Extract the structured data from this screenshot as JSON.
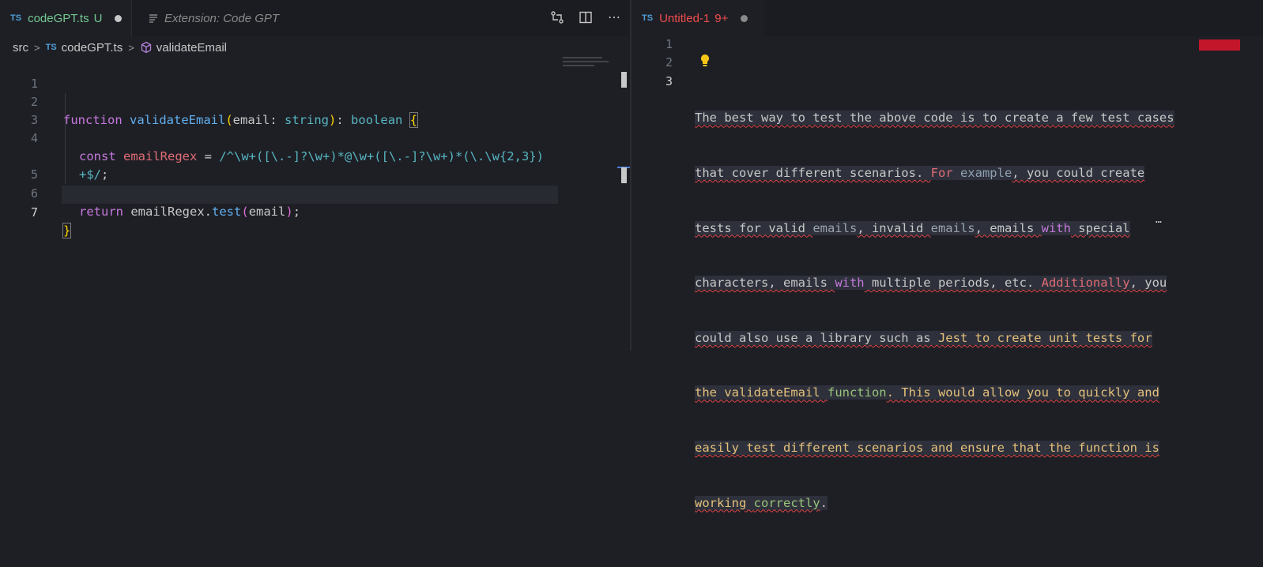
{
  "left_tabs": [
    {
      "badge": "TS",
      "title": "codeGPT.ts",
      "status": "U"
    },
    {
      "title": "Extension: Code GPT"
    }
  ],
  "breadcrumb": {
    "folder": "src",
    "file_badge": "TS",
    "file": "codeGPT.ts",
    "symbol": "validateEmail"
  },
  "left_code": {
    "line_numbers": [
      "1",
      "2",
      "3",
      "4",
      "",
      "5",
      "6",
      "7"
    ],
    "l2": {
      "kw": "function",
      "name": "validateEmail",
      "open": "(",
      "param": "email",
      "colon": ": ",
      "ptype": "string",
      "close": ")",
      "colon2": ": ",
      "rtype": "boolean",
      "brace": "{"
    },
    "l4": {
      "kw": "const",
      "var": "emailRegex",
      "eq": " = ",
      "regex_a": "/^\\w+([\\.-]?\\w+)*@\\w+([\\.-]?\\w+)*(\\.\\w{2,3})",
      "regex_b": "+$/",
      "semi": ";"
    },
    "l6": {
      "kw": "return",
      "obj": "emailRegex",
      "dot": ".",
      "method": "test",
      "open": "(",
      "arg": "email",
      "close": ")",
      "semi": ";"
    },
    "l7": {
      "brace": "}"
    }
  },
  "right_tab": {
    "badge": "TS",
    "title": "Untitled-1",
    "count": "9+"
  },
  "right_lines": [
    "1",
    "2",
    "3"
  ],
  "prose": {
    "l1": [
      "The best way to test the above code is to create a few test cases"
    ],
    "l2a": "that cover different scenarios. ",
    "l2b": "For",
    "l2c": " example",
    "l2d": ", you could create",
    "l3a": "tests for valid ",
    "l3b": "emails",
    "l3c": ", invalid ",
    "l3d": "emails",
    "l3e": ", emails ",
    "l3f": "with",
    "l3g": " special",
    "l4a": "characters, emails ",
    "l4b": "with",
    "l4c": " multiple periods, etc. ",
    "l4d": "Additionally",
    "l4e": ", you",
    "l5a": "could also use a library such as ",
    "l5b": "Jest to create unit tests for",
    "l6a": "the validateEmail ",
    "l6b": "function",
    "l6c": ". This would allow you to quickly and",
    "l7": "easily test different scenarios and ensure that the function is",
    "l8a": "working ",
    "l8b": "correctly",
    "l8c": ".",
    "ellipsis": "…"
  }
}
